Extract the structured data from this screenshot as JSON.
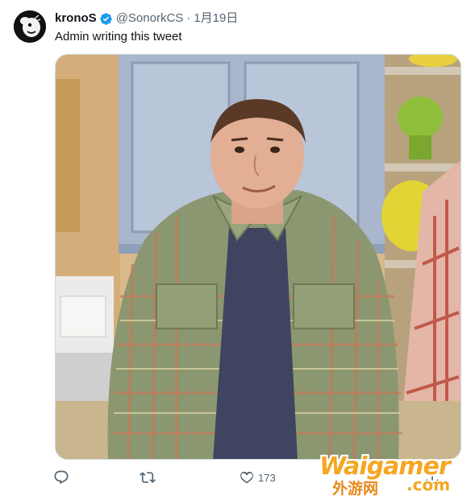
{
  "author": {
    "name": "kronoS",
    "handle": "@SonorkCS",
    "separator": "·",
    "date": "1月19日",
    "verified": true
  },
  "tweet": {
    "text": "Admin writing this tweet"
  },
  "actions": {
    "reply_count": "",
    "retweet_count": "",
    "like_count": "173"
  },
  "watermark": {
    "main": "Waigamer",
    "sub": "外游网",
    "dotcom": ".com"
  },
  "icons": {
    "verified": "verified-badge-icon",
    "reply": "reply-icon",
    "retweet": "retweet-icon",
    "like": "heart-icon",
    "share": "share-icon"
  },
  "colors": {
    "verified": "#1d9bf0",
    "muted": "#536471",
    "text": "#0f1419",
    "watermark": "#f5a623"
  }
}
